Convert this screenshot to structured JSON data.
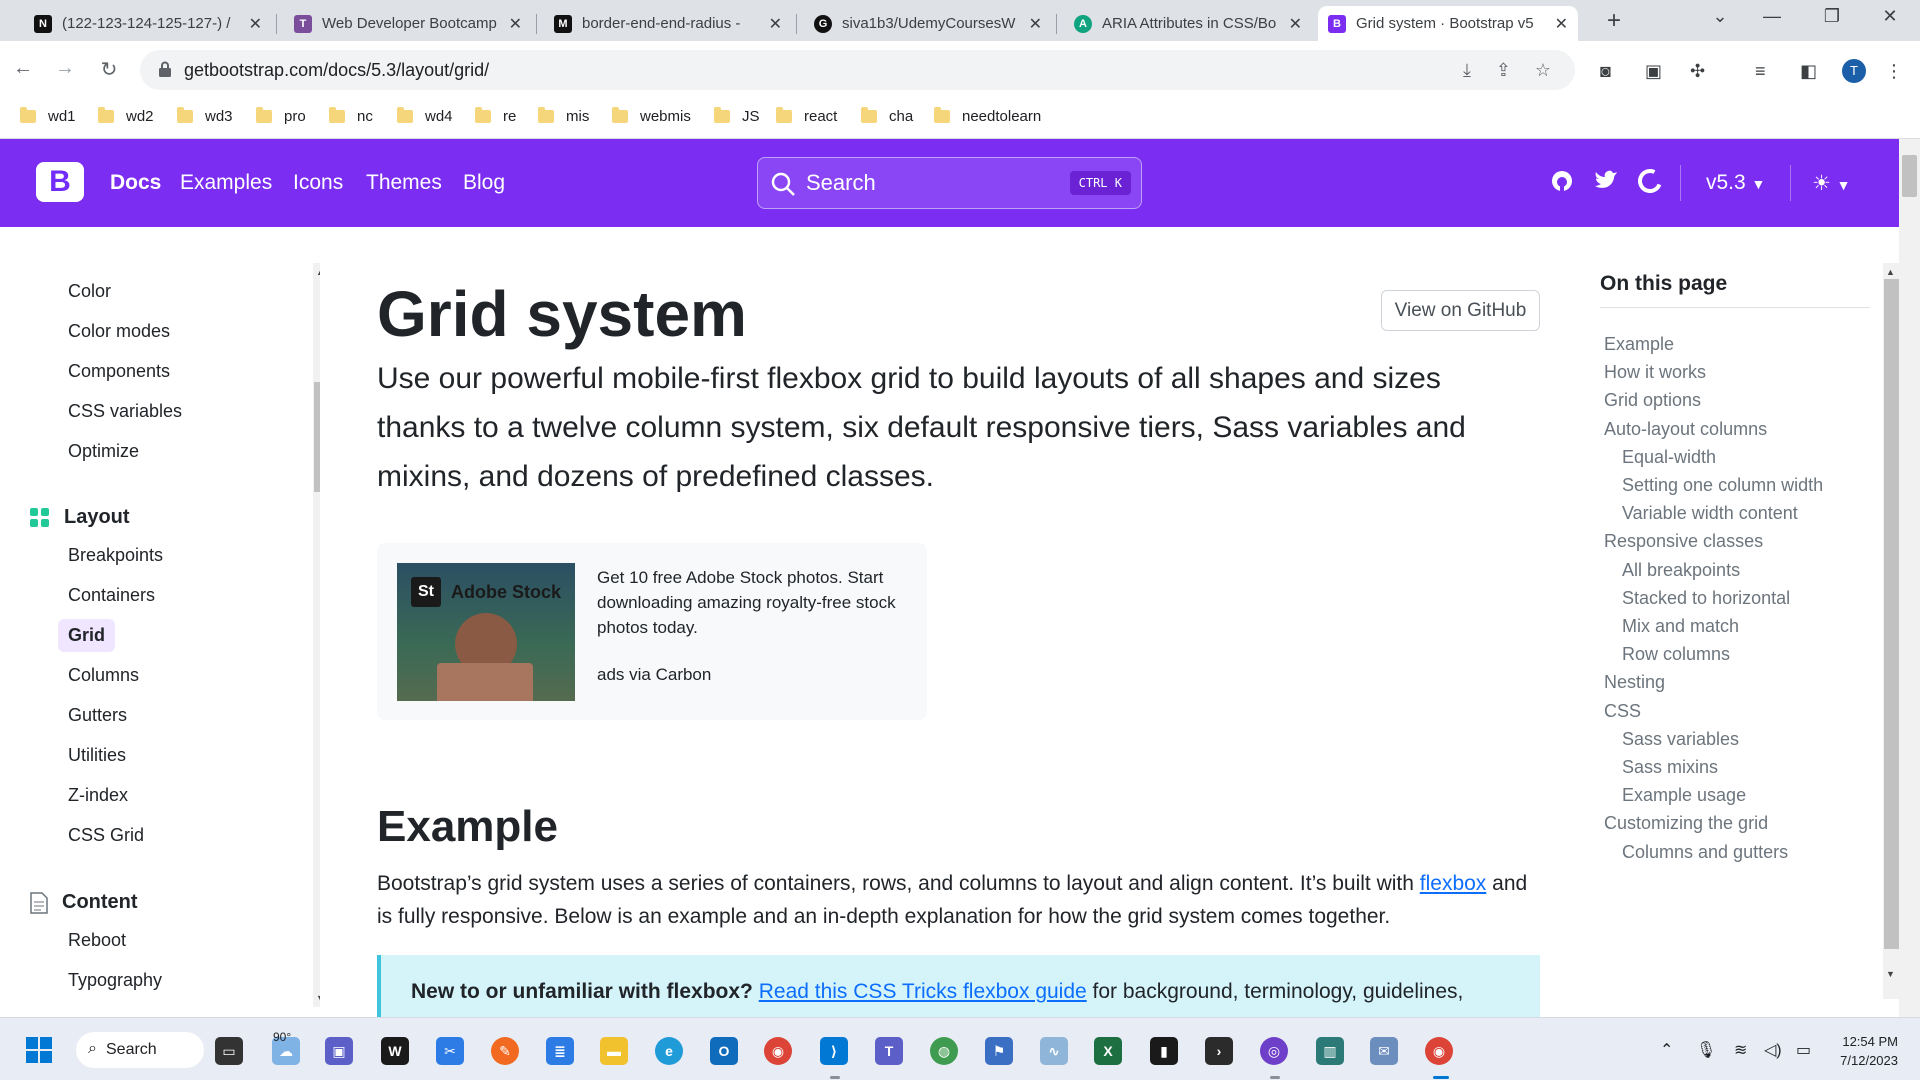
{
  "browser": {
    "tabs": [
      {
        "label": "(122-123-124-125-127-) / ",
        "favicon": "N",
        "color": "#111111"
      },
      {
        "label": "Web Developer Bootcamp",
        "favicon": "T",
        "color": "#7a4e9a"
      },
      {
        "label": "border-end-end-radius - ",
        "favicon": "M",
        "color": "#111111"
      },
      {
        "label": "siva1b3/UdemyCoursesW",
        "favicon": "G",
        "color": "#111111"
      },
      {
        "label": "ARIA Attributes in CSS/Bo",
        "favicon": "A",
        "color": "#10a37f"
      },
      {
        "label": "Grid system · Bootstrap v5",
        "favicon": "B",
        "color": "#7c2df2"
      }
    ],
    "url": "getbootstrap.com/docs/5.3/layout/grid/",
    "profile_initial": "T",
    "bookmarks": [
      "wd1",
      "wd2",
      "wd3",
      "pro",
      "nc",
      "wd4",
      "re",
      "mis",
      "webmis",
      "JS",
      "react",
      "cha",
      "needtolearn"
    ]
  },
  "navbar": {
    "logo": "B",
    "links": [
      "Docs",
      "Examples",
      "Icons",
      "Themes",
      "Blog"
    ],
    "search_placeholder": "Search",
    "search_shortcut_ctrl": "CTRL",
    "search_shortcut_key": "K",
    "version": "v5.3"
  },
  "sidebar": {
    "top_items": [
      "Color",
      "Color modes",
      "Components",
      "CSS variables",
      "Optimize"
    ],
    "layout_heading": "Layout",
    "layout_items": [
      "Breakpoints",
      "Containers",
      "Grid",
      "Columns",
      "Gutters",
      "Utilities",
      "Z-index",
      "CSS Grid"
    ],
    "content_heading": "Content",
    "content_items": [
      "Reboot",
      "Typography"
    ]
  },
  "main": {
    "title": "Grid system",
    "github_button": "View on GitHub",
    "lead": "Use our powerful mobile-first flexbox grid to build layouts of all shapes and sizes thanks to a twelve column system, six default responsive tiers, Sass variables and mixins, and dozens of predefined classes.",
    "ad": {
      "logo": "St",
      "brand": "Adobe Stock",
      "text": "Get 10 free Adobe Stock photos. Start downloading amazing royalty-free stock photos today.",
      "sub": "ads via Carbon"
    },
    "example_heading": "Example",
    "para_before": "Bootstrap’s grid system uses a series of containers, rows, and columns to layout and align content. It’s built with ",
    "para_link": "flexbox",
    "para_after": " and is fully responsive. Below is an example and an in-depth explanation for how the grid system comes together.",
    "callout_bold": "New to or unfamiliar with flexbox?",
    "callout_link": "Read this CSS Tricks flexbox guide",
    "callout_after": " for background, terminology, guidelines,"
  },
  "toc": {
    "title": "On this page",
    "items": [
      {
        "label": "Example",
        "indent": false
      },
      {
        "label": "How it works",
        "indent": false
      },
      {
        "label": "Grid options",
        "indent": false
      },
      {
        "label": "Auto-layout columns",
        "indent": false
      },
      {
        "label": "Equal-width",
        "indent": true
      },
      {
        "label": "Setting one column width",
        "indent": true
      },
      {
        "label": "Variable width content",
        "indent": true
      },
      {
        "label": "Responsive classes",
        "indent": false
      },
      {
        "label": "All breakpoints",
        "indent": true
      },
      {
        "label": "Stacked to horizontal",
        "indent": true
      },
      {
        "label": "Mix and match",
        "indent": true
      },
      {
        "label": "Row columns",
        "indent": true
      },
      {
        "label": "Nesting",
        "indent": false
      },
      {
        "label": "CSS",
        "indent": false
      },
      {
        "label": "Sass variables",
        "indent": true
      },
      {
        "label": "Sass mixins",
        "indent": true
      },
      {
        "label": "Example usage",
        "indent": true
      },
      {
        "label": "Customizing the grid",
        "indent": false
      },
      {
        "label": "Columns and gutters",
        "indent": true
      }
    ]
  },
  "taskbar": {
    "search_label": "Search",
    "weather": "90°",
    "time": "12:54 PM",
    "date": "7/12/2023"
  }
}
